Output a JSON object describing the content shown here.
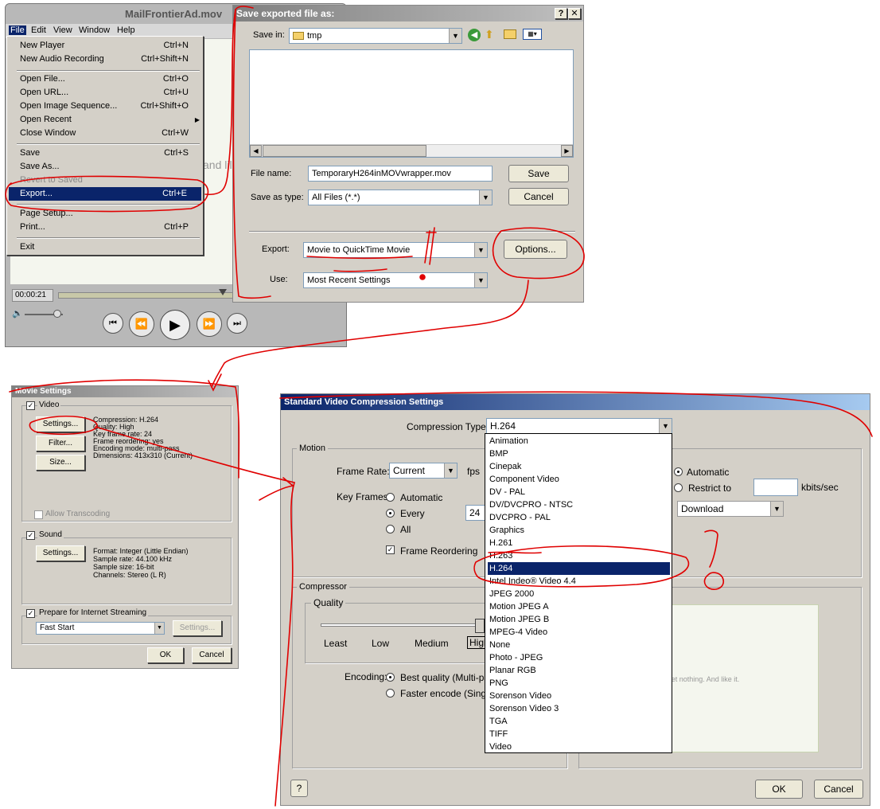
{
  "player": {
    "title": "MailFrontierAd.mov",
    "menubar": [
      "File",
      "Edit",
      "View",
      "Window",
      "Help"
    ],
    "time": "00:00:21",
    "bg_text": "and lil"
  },
  "file_menu": {
    "items": [
      {
        "label": "New Player",
        "shortcut": "Ctrl+N"
      },
      {
        "label": "New Audio Recording",
        "shortcut": "Ctrl+Shift+N"
      },
      {
        "label": "Open File...",
        "shortcut": "Ctrl+O"
      },
      {
        "label": "Open URL...",
        "shortcut": "Ctrl+U"
      },
      {
        "label": "Open Image Sequence...",
        "shortcut": "Ctrl+Shift+O"
      },
      {
        "label": "Open Recent",
        "shortcut": ""
      },
      {
        "label": "Close Window",
        "shortcut": "Ctrl+W"
      },
      {
        "label": "Save",
        "shortcut": "Ctrl+S"
      },
      {
        "label": "Save As...",
        "shortcut": ""
      },
      {
        "label": "Revert to Saved",
        "shortcut": ""
      },
      {
        "label": "Export...",
        "shortcut": "Ctrl+E"
      },
      {
        "label": "Page Setup...",
        "shortcut": ""
      },
      {
        "label": "Print...",
        "shortcut": "Ctrl+P"
      },
      {
        "label": "Exit",
        "shortcut": ""
      }
    ]
  },
  "save_dialog": {
    "title": "Save exported file as:",
    "save_in_label": "Save in:",
    "save_in_value": "tmp",
    "file_name_label": "File name:",
    "file_name_value": "TemporaryH264inMOVwrapper.mov",
    "save_as_type_label": "Save as type:",
    "save_as_type_value": "All Files (*.*)",
    "save_btn": "Save",
    "cancel_btn": "Cancel",
    "export_label": "Export:",
    "export_value": "Movie to QuickTime Movie",
    "options_btn": "Options...",
    "use_label": "Use:",
    "use_value": "Most Recent Settings",
    "help_btn": "?",
    "close_btn": "✕"
  },
  "movie_settings": {
    "title": "Movie Settings",
    "video_label": "Video",
    "settings_btn": "Settings...",
    "filter_btn": "Filter...",
    "size_btn": "Size...",
    "video_info": [
      "Compression: H.264",
      "Quality: High",
      "Key frame rate: 24",
      "Frame reordering: yes",
      "Encoding mode: multi-pass",
      "Dimensions: 413x310 (Current)"
    ],
    "allow_transcoding": "Allow Transcoding",
    "sound_label": "Sound",
    "sound_settings_btn": "Settings...",
    "sound_info": [
      "Format: Integer (Little Endian)",
      "Sample rate: 44.100 kHz",
      "Sample size: 16-bit",
      "Channels: Stereo (L R)"
    ],
    "streaming_label": "Prepare for Internet Streaming",
    "streaming_value": "Fast Start",
    "streaming_settings_btn": "Settings...",
    "ok_btn": "OK",
    "cancel_btn": "Cancel"
  },
  "compression": {
    "title": "Standard Video Compression Settings",
    "type_label": "Compression Type:",
    "type_value": "H.264",
    "motion_label": "Motion",
    "frame_rate_label": "Frame Rate:",
    "frame_rate_value": "Current",
    "fps_label": "fps",
    "key_frames_label": "Key Frames:",
    "kf_automatic": "Automatic",
    "kf_every": "Every",
    "kf_every_value": "24",
    "kf_all": "All",
    "frame_reordering": "Frame Reordering",
    "dr_automatic": "Automatic",
    "dr_restrict": "Restrict to",
    "kbits_label": "kbits/sec",
    "optimize_value": "Download",
    "compressor_label": "Compressor",
    "quality_label": "Quality",
    "quality_ticks": [
      "Least",
      "Low",
      "Medium",
      "High"
    ],
    "encoding_label": "Encoding:",
    "enc_best": "Best quality (Multi-pass)",
    "enc_faster": "Faster encode (Single-pass)",
    "preview_text": "you'll get nothing. And like it.",
    "help_btn": "?",
    "ok_btn": "OK",
    "cancel_btn": "Cancel",
    "codec_list": [
      "Animation",
      "BMP",
      "Cinepak",
      "Component Video",
      "DV - PAL",
      "DV/DVCPRO - NTSC",
      "DVCPRO - PAL",
      "Graphics",
      "H.261",
      "H.263",
      "H.264",
      "Intel Indeo® Video 4.4",
      "JPEG 2000",
      "Motion JPEG A",
      "Motion JPEG B",
      "MPEG-4 Video",
      "None",
      "Photo - JPEG",
      "Planar RGB",
      "PNG",
      "Sorenson Video",
      "Sorenson Video 3",
      "TGA",
      "TIFF",
      "Video"
    ]
  }
}
